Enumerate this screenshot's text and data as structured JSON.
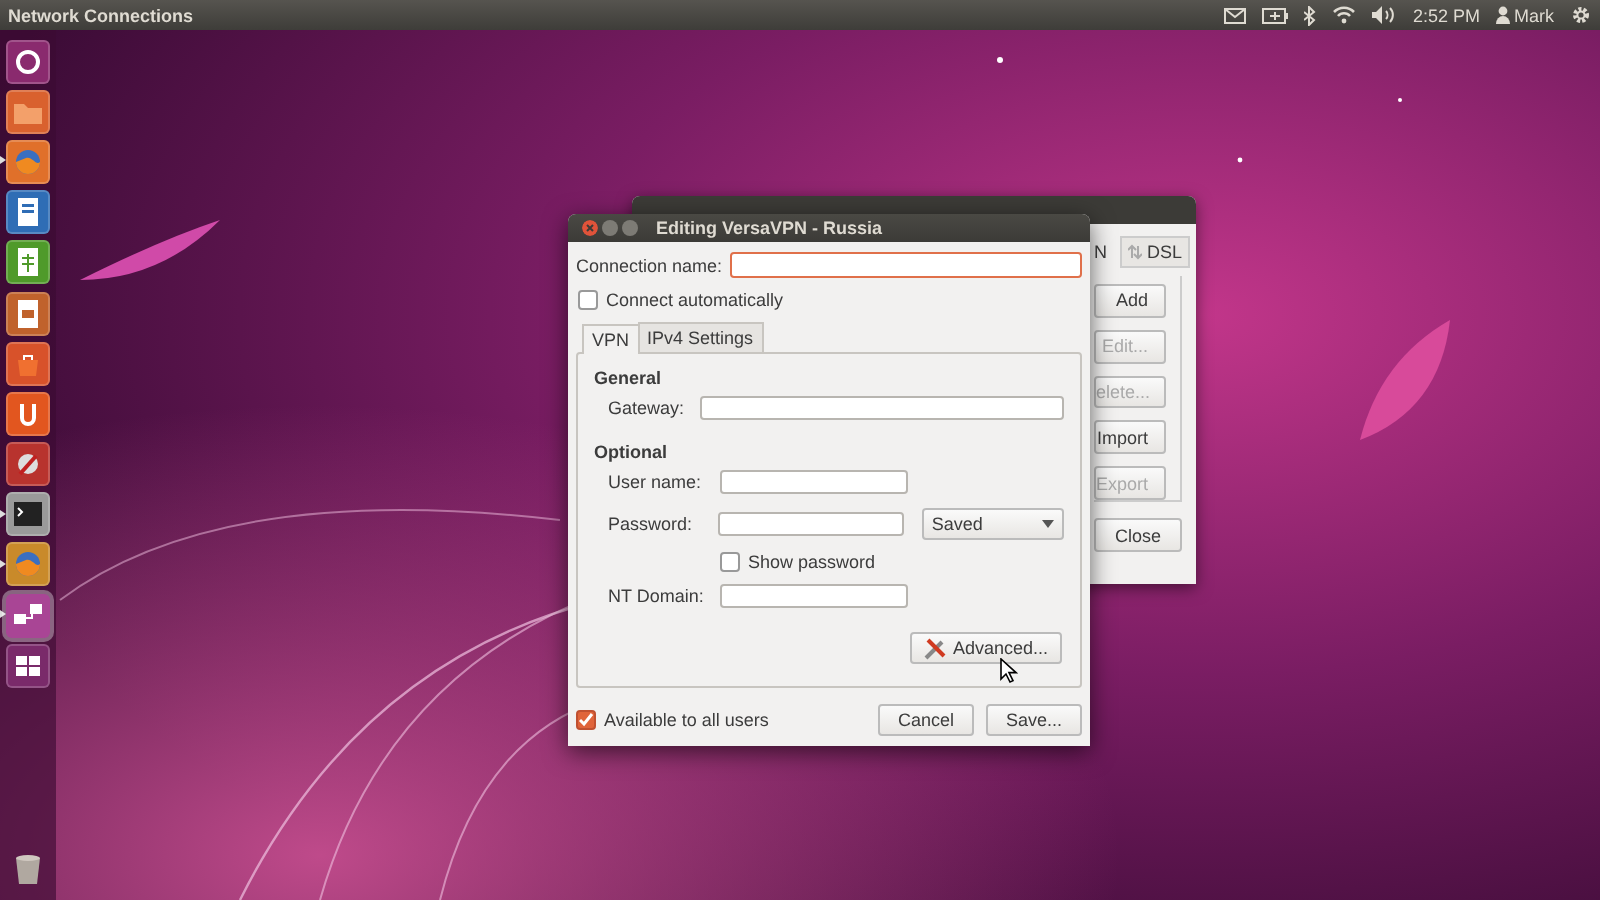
{
  "top_panel": {
    "app_title": "Network Connections",
    "clock": "2:52 PM",
    "user": "Mark"
  },
  "launcher": {
    "items": [
      {
        "kind": "ubuntu",
        "color": "#8a2a6e",
        "running": false,
        "selected": false
      },
      {
        "kind": "folder",
        "color": "#d9612e",
        "running": false,
        "selected": false
      },
      {
        "kind": "globe",
        "color": "#e0702a",
        "running": true,
        "selected": false
      },
      {
        "kind": "doc",
        "color": "#2f6db5",
        "running": false,
        "selected": false
      },
      {
        "kind": "sheet",
        "color": "#4f9a2a",
        "running": false,
        "selected": false
      },
      {
        "kind": "slides",
        "color": "#c0622c",
        "running": false,
        "selected": false
      },
      {
        "kind": "bag",
        "color": "#d8522a",
        "running": false,
        "selected": false
      },
      {
        "kind": "cloud",
        "color": "#e2561f",
        "running": false,
        "selected": false
      },
      {
        "kind": "gear",
        "color": "#b8332e",
        "running": false,
        "selected": false
      },
      {
        "kind": "terminal",
        "color": "#9a9a9a",
        "running": true,
        "selected": false
      },
      {
        "kind": "globe",
        "color": "#c98a2a",
        "running": true,
        "selected": false
      },
      {
        "kind": "network",
        "color": "#a94595",
        "running": true,
        "selected": true
      },
      {
        "kind": "workspaces",
        "color": "#7a2a6a",
        "running": false,
        "selected": false
      }
    ]
  },
  "back_window": {
    "tabs": [
      {
        "label": "N"
      },
      {
        "label": "DSL"
      }
    ],
    "buttons": [
      {
        "label": "Add",
        "disabled": false
      },
      {
        "label": "Edit...",
        "disabled": true
      },
      {
        "label": "elete...",
        "disabled": true
      },
      {
        "label": "Import",
        "disabled": false
      },
      {
        "label": "Export",
        "disabled": true
      }
    ],
    "close": "Close"
  },
  "dialog": {
    "title": "Editing VersaVPN - Russia",
    "connection_name": {
      "label": "Connection name:",
      "focused": true
    },
    "connect_automatically": {
      "label": "Connect automatically",
      "checked": false
    },
    "tabs": [
      {
        "label": "VPN",
        "selected": true
      },
      {
        "label": "IPv4 Settings",
        "selected": false
      }
    ],
    "general": {
      "heading": "General",
      "gateway": "Gateway:"
    },
    "optional": {
      "heading": "Optional",
      "user_name": "User name:",
      "password": "Password:",
      "password_mode": "Saved",
      "show_password": {
        "label": "Show password",
        "checked": false
      },
      "nt_domain": "NT Domain:"
    },
    "advanced": "Advanced...",
    "available_to_all": {
      "label": "Available to all users",
      "checked": true
    },
    "buttons": [
      "Cancel",
      "Save..."
    ]
  }
}
